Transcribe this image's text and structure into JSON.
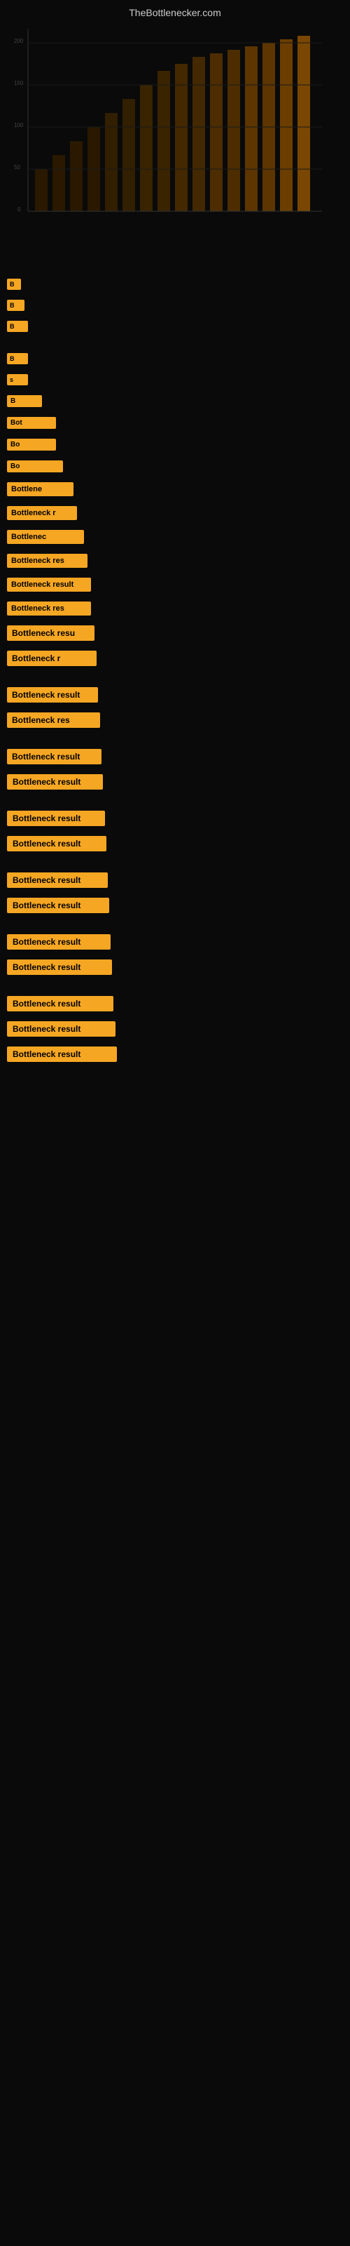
{
  "site": {
    "title": "TheBottlenecker.com"
  },
  "bottleneck_items": [
    {
      "id": 1,
      "label": "B",
      "class": "bn-1",
      "gap": false
    },
    {
      "id": 2,
      "label": "B",
      "class": "bn-2",
      "gap": false
    },
    {
      "id": 3,
      "label": "B",
      "class": "bn-3",
      "gap": false
    },
    {
      "id": 4,
      "label": "B",
      "class": "bn-4",
      "gap": true
    },
    {
      "id": 5,
      "label": "s",
      "class": "bn-5",
      "gap": false
    },
    {
      "id": 6,
      "label": "B",
      "class": "bn-6",
      "gap": false
    },
    {
      "id": 7,
      "label": "Bot",
      "class": "bn-7",
      "gap": false
    },
    {
      "id": 8,
      "label": "Bo",
      "class": "bn-8",
      "gap": false
    },
    {
      "id": 9,
      "label": "Bo",
      "class": "bn-9",
      "gap": false
    },
    {
      "id": 10,
      "label": "Bottlene",
      "class": "bn-10",
      "gap": false
    },
    {
      "id": 11,
      "label": "Bottleneck r",
      "class": "bn-11",
      "gap": false
    },
    {
      "id": 12,
      "label": "Bottlenec",
      "class": "bn-12",
      "gap": false
    },
    {
      "id": 13,
      "label": "Bottleneck res",
      "class": "bn-13",
      "gap": false
    },
    {
      "id": 14,
      "label": "Bottleneck result",
      "class": "bn-14",
      "gap": false
    },
    {
      "id": 15,
      "label": "Bottleneck res",
      "class": "bn-15",
      "gap": false
    },
    {
      "id": 16,
      "label": "Bottleneck resu",
      "class": "bn-16",
      "gap": false
    },
    {
      "id": 17,
      "label": "Bottleneck r",
      "class": "bn-17",
      "gap": false
    },
    {
      "id": 18,
      "label": "Bottleneck result",
      "class": "bn-18",
      "gap": true
    },
    {
      "id": 19,
      "label": "Bottleneck res",
      "class": "bn-19",
      "gap": false
    },
    {
      "id": 20,
      "label": "Bottleneck result",
      "class": "bn-20",
      "gap": true
    },
    {
      "id": 21,
      "label": "Bottleneck result",
      "class": "bn-21",
      "gap": false
    },
    {
      "id": 22,
      "label": "Bottleneck result",
      "class": "bn-22",
      "gap": true
    },
    {
      "id": 23,
      "label": "Bottleneck result",
      "class": "bn-23",
      "gap": false
    },
    {
      "id": 24,
      "label": "Bottleneck result",
      "class": "bn-24",
      "gap": true
    },
    {
      "id": 25,
      "label": "Bottleneck result",
      "class": "bn-25",
      "gap": false
    },
    {
      "id": 26,
      "label": "Bottleneck result",
      "class": "bn-26",
      "gap": true
    },
    {
      "id": 27,
      "label": "Bottleneck result",
      "class": "bn-27",
      "gap": false
    },
    {
      "id": 28,
      "label": "Bottleneck result",
      "class": "bn-28",
      "gap": true
    },
    {
      "id": 29,
      "label": "Bottleneck result",
      "class": "bn-29",
      "gap": false
    },
    {
      "id": 30,
      "label": "Bottleneck result",
      "class": "bn-30",
      "gap": false
    }
  ],
  "colors": {
    "background": "#0a0a0a",
    "label_bg": "#f5a623",
    "label_text": "#000000",
    "site_title": "#cccccc"
  }
}
